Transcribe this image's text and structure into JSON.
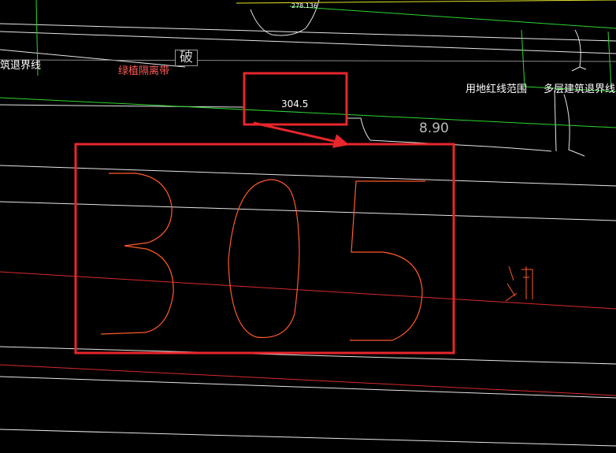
{
  "drawing": {
    "labels": {
      "top_elevation": "278.136",
      "building_setback_left": "筑退界线",
      "green_belt": "绿植隔离带",
      "slope_symbol": "破",
      "elevation_small": "304.5",
      "land_red_line": "用地红线范围",
      "multistory_setback": "多层建筑退界线",
      "value_right": "8.90",
      "lake": "湖"
    },
    "big_number": "305",
    "colors": {
      "background": "#000000",
      "highlight_box": "#e8262b",
      "contour_white": "#e6e6e6",
      "boundary_green": "#2dd62d",
      "road_yellow": "#e5e52b",
      "red_line": "#d72a2a",
      "orange_text": "#ff5a2a"
    }
  }
}
